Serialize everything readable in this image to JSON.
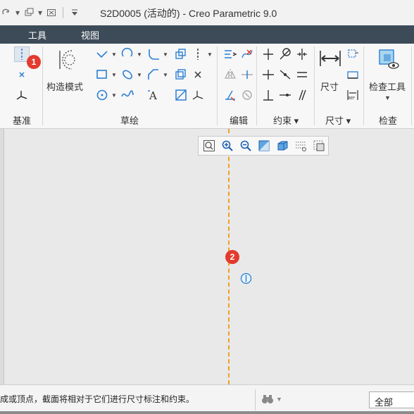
{
  "window": {
    "title": "S2D0005 (活动的) - Creo Parametric 9.0"
  },
  "menubar": {
    "items": [
      {
        "label": "工具"
      },
      {
        "label": "视图"
      }
    ]
  },
  "ribbon": {
    "groups": [
      {
        "label": "基准"
      },
      {
        "label": "草绘"
      },
      {
        "label": "编辑"
      },
      {
        "label": "约束 ▾"
      },
      {
        "label": "尺寸 ▾"
      },
      {
        "label": "检查"
      }
    ],
    "buttons": {
      "construction_mode": "构造模式",
      "dimension": "尺寸",
      "inspect_tools": "检查工具",
      "ref_label": "REF"
    }
  },
  "badges": [
    {
      "number": "1"
    },
    {
      "number": "2"
    }
  ],
  "statusbar": {
    "message": "成或顶点，截面将相对于它们进行尺寸标注和约束。",
    "filter_value": "全部"
  },
  "colors": {
    "menubar": "#3c4b57",
    "centerline": "#f0a020",
    "badge": "#e33b2e",
    "constraint_icon": "#2a7fd4"
  }
}
